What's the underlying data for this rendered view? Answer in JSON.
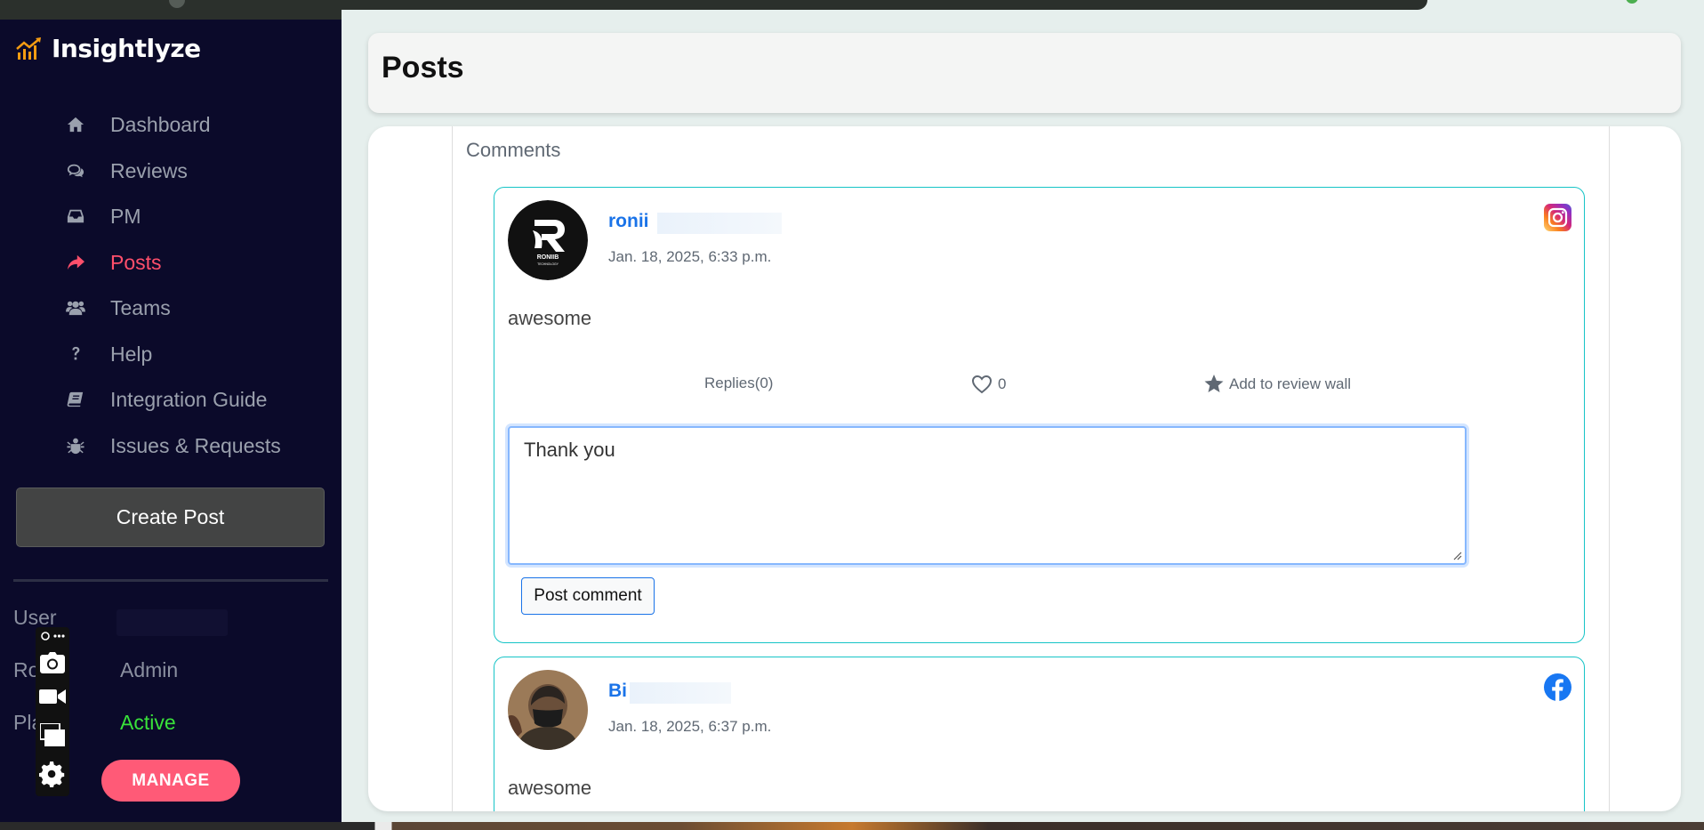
{
  "app": {
    "name": "Insightlyze"
  },
  "sidebar": {
    "items": [
      {
        "label": "Dashboard",
        "icon": "home-icon"
      },
      {
        "label": "Reviews",
        "icon": "comments-icon"
      },
      {
        "label": "PM",
        "icon": "inbox-icon"
      },
      {
        "label": "Posts",
        "icon": "share-icon",
        "active": true
      },
      {
        "label": "Teams",
        "icon": "users-icon"
      },
      {
        "label": "Help",
        "icon": "question-icon"
      },
      {
        "label": "Integration Guide",
        "icon": "book-icon"
      },
      {
        "label": "Issues & Requests",
        "icon": "bug-icon"
      }
    ],
    "create_post_label": "Create Post",
    "user_label": "User",
    "role_label": "Ro",
    "role_value": "Admin",
    "plan_label": "Pla",
    "plan_value": "Active",
    "manage_label": "MANAGE"
  },
  "page": {
    "title": "Posts"
  },
  "comments": {
    "title": "Comments",
    "items": [
      {
        "username": "ronii",
        "date": "Jan. 18, 2025, 6:33 p.m.",
        "text": "awesome",
        "platform": "instagram-icon",
        "replies_label": "Replies(0)",
        "likes": "0",
        "review_wall_label": "Add to review wall",
        "reply_text": "Thank you",
        "post_button_label": "Post comment",
        "avatar_text": "RONIIB",
        "avatar_subtext": "TECHNOLOGY"
      },
      {
        "username": "Bi",
        "date": "Jan. 18, 2025, 6:37 p.m.",
        "text": "awesome",
        "platform": "facebook-icon"
      }
    ]
  },
  "colors": {
    "sidebar_bg": "#0b0a2a",
    "active": "#ff4f6b",
    "manage": "#ff5a77",
    "plan_active": "#39e23a",
    "card_border": "#16c4c7",
    "username": "#1a73e8"
  }
}
